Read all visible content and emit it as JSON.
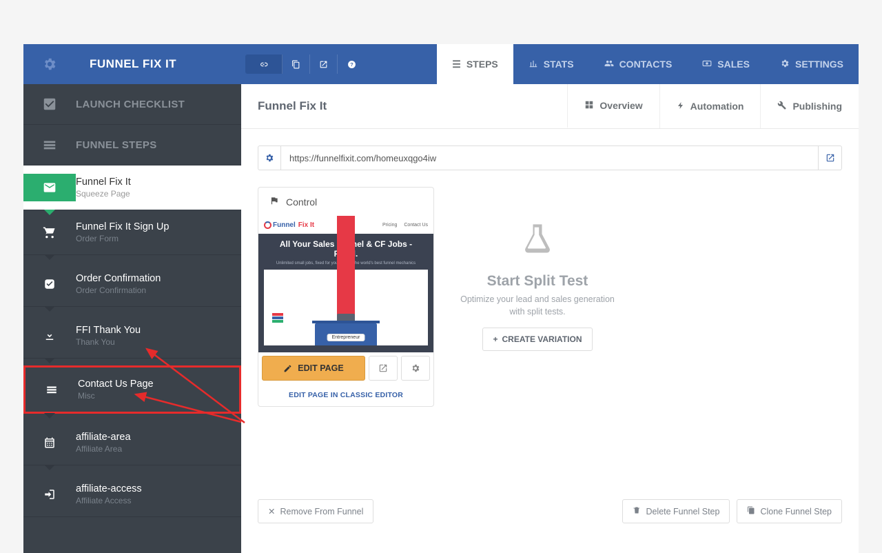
{
  "header": {
    "title": "FUNNEL FIX IT",
    "nav": [
      {
        "label": "STEPS",
        "active": true
      },
      {
        "label": "STATS",
        "active": false
      },
      {
        "label": "CONTACTS",
        "active": false
      },
      {
        "label": "SALES",
        "active": false
      },
      {
        "label": "SETTINGS",
        "active": false
      }
    ]
  },
  "sidebar": {
    "launch": "LAUNCH CHECKLIST",
    "funnel_steps": "FUNNEL STEPS",
    "steps": [
      {
        "title": "Funnel Fix It",
        "sub": "Squeeze Page",
        "icon": "envelope",
        "active": true
      },
      {
        "title": "Funnel Fix It Sign Up",
        "sub": "Order Form",
        "icon": "cart"
      },
      {
        "title": "Order Confirmation",
        "sub": "Order Confirmation",
        "icon": "check-square"
      },
      {
        "title": "FFI Thank You",
        "sub": "Thank You",
        "icon": "download"
      },
      {
        "title": "Contact Us Page",
        "sub": "Misc",
        "icon": "menu",
        "highlighted": true
      },
      {
        "title": "affiliate-area",
        "sub": "Affiliate Area",
        "icon": "calendar"
      },
      {
        "title": "affiliate-access",
        "sub": "Affiliate Access",
        "icon": "login"
      }
    ]
  },
  "main": {
    "title": "Funnel Fix It",
    "subtabs": [
      {
        "label": "Overview",
        "active": true
      },
      {
        "label": "Automation",
        "active": false
      },
      {
        "label": "Publishing",
        "active": false
      }
    ],
    "url": "https://funnelfixit.com/homeuxqgo4iw",
    "control_label": "Control",
    "preview": {
      "brand_a": "Funnel",
      "brand_b": "Fix It",
      "nav1": "Pricing",
      "nav2": "Contact Us",
      "hero": "All Your Sales Funnel & CF Jobs - Fixed.",
      "subhero": "Unlimited small jobs, fixed for you 24/7 by the world's best funnel mechanics",
      "badge": "Entrepreneur"
    },
    "edit_page": "EDIT PAGE",
    "classic": "EDIT PAGE IN CLASSIC EDITOR",
    "split": {
      "title": "Start Split Test",
      "desc": "Optimize your lead and sales generation with split tests.",
      "button": "CREATE VARIATION"
    },
    "footer": {
      "remove": "Remove From Funnel",
      "delete": "Delete Funnel Step",
      "clone": "Clone Funnel Step"
    }
  }
}
